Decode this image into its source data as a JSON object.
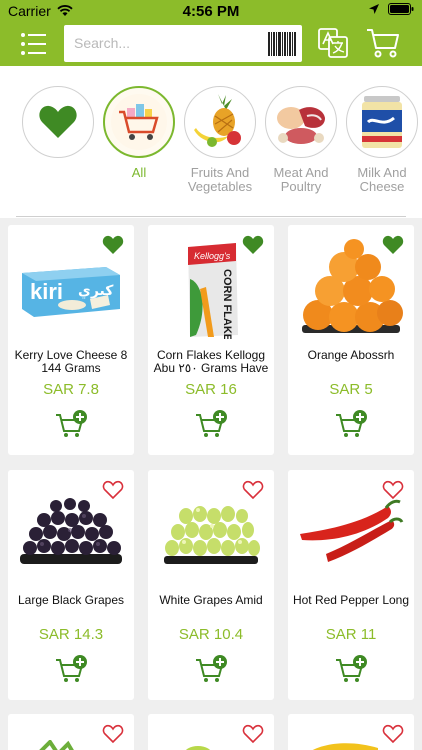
{
  "status": {
    "carrier": "Carrier",
    "time": "4:56 PM"
  },
  "search": {
    "placeholder": "Search..."
  },
  "categories": [
    {
      "label": "",
      "icon": "heart-icon"
    },
    {
      "label": "All"
    },
    {
      "label": "Fruits And Vegetables"
    },
    {
      "label": "Meat And Poultry"
    },
    {
      "label": "Milk And Cheese"
    }
  ],
  "products": [
    {
      "name": "Kerry Love Cheese 8 144 Grams",
      "price": "SAR 7.8",
      "favorite": true
    },
    {
      "name": "Corn Flakes Kellogg Abu ٢٥٠ Grams Have",
      "price": "SAR 16",
      "favorite": true
    },
    {
      "name": "Orange Abossrh",
      "price": "SAR 5",
      "favorite": true
    },
    {
      "name": "Large Black Grapes",
      "price": "SAR 14.3",
      "favorite": false
    },
    {
      "name": "White Grapes Amid",
      "price": "SAR 10.4",
      "favorite": false
    },
    {
      "name": "Hot Red Pepper Long",
      "price": "SAR 11",
      "favorite": false
    }
  ],
  "colors": {
    "accent": "#8cbc2a",
    "active": "#7cb82f",
    "heart": "#3f8a24",
    "heart_outline": "#d9303b"
  }
}
